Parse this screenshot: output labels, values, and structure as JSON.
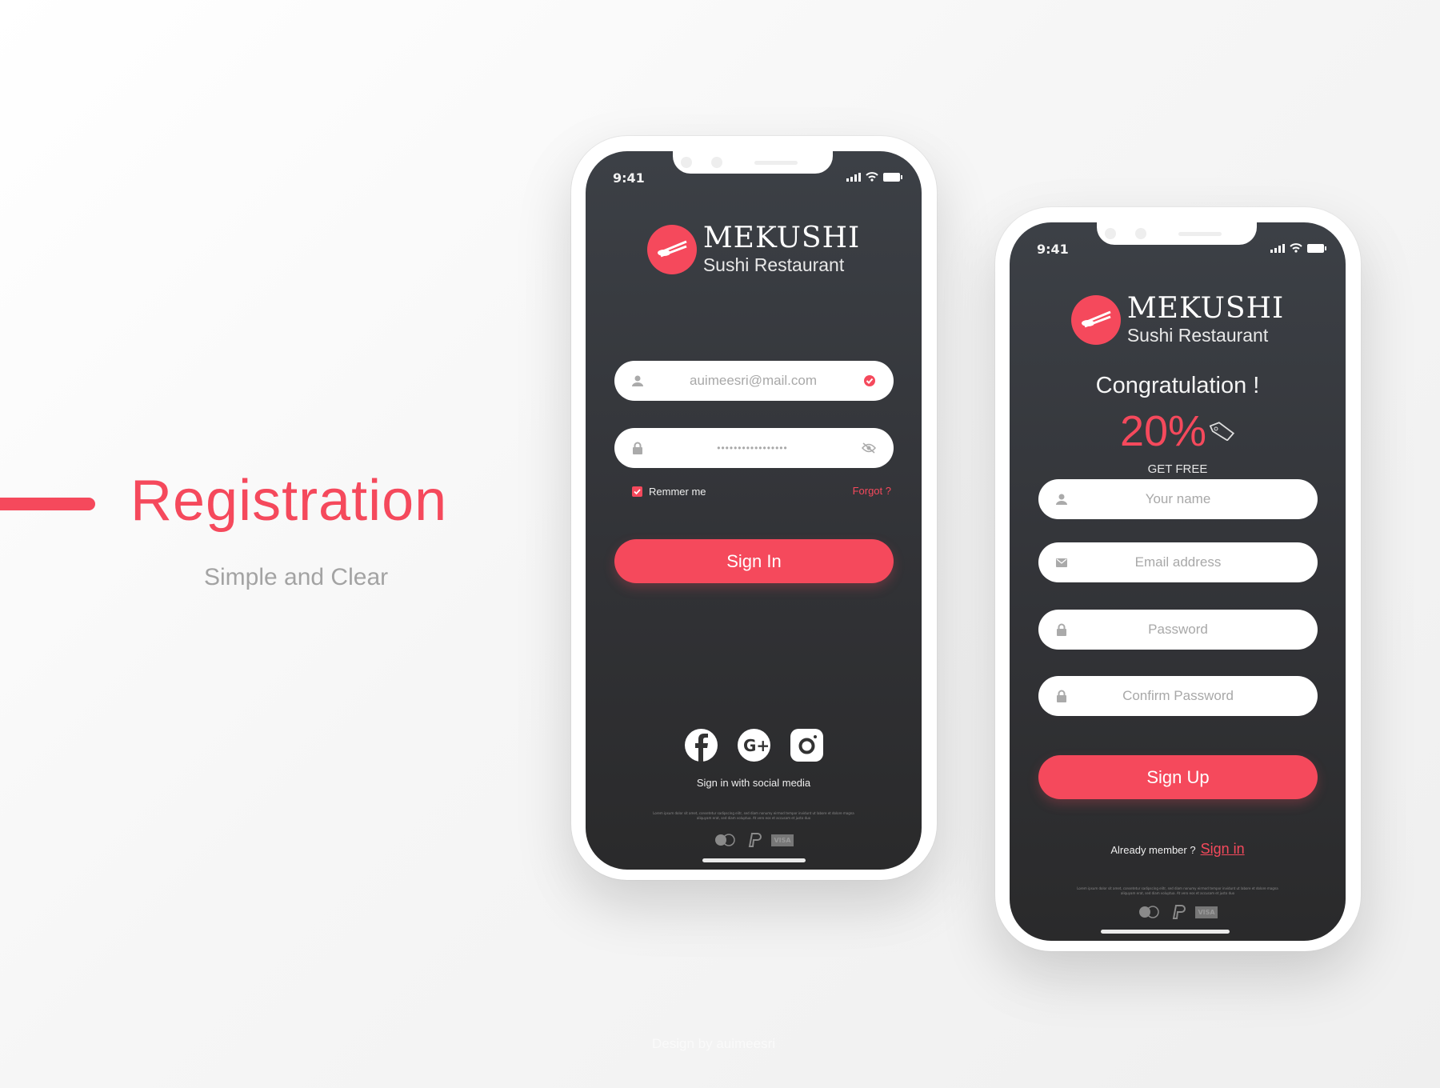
{
  "hero": {
    "title": "Registration",
    "subtitle": "Simple and Clear",
    "credit": "Design by auimeesri"
  },
  "colors": {
    "accent": "#f5495c",
    "screen": "#35373b"
  },
  "login": {
    "status_time": "9:41",
    "brand": {
      "name": "MEKUSHI",
      "tagline": "Sushi Restaurant"
    },
    "email": {
      "value": "auimeesri@mail.com",
      "icon": "user-icon",
      "status_icon": "check-circle-icon"
    },
    "password": {
      "value": "•••••••••••••••••",
      "icon": "lock-icon",
      "toggle_icon": "eye-off-icon"
    },
    "remember_label": "Remmer me",
    "remember_checked": true,
    "forgot_label": "Forgot ?",
    "submit_label": "Sign In",
    "social_icons": [
      "facebook-icon",
      "google-plus-icon",
      "instagram-icon"
    ],
    "social_caption": "Sign in with social media",
    "fine_print": "Lorem ipsum dolor sit amet, consetetur sadipscing elitr, sed diam nonumy eirmod tempor invidunt ut labore et dolore magna aliquyam erat, sed diam voluptua. At vero eos et accusam et justo duo",
    "payments": {
      "visa": "VISA"
    }
  },
  "signup": {
    "status_time": "9:41",
    "brand": {
      "name": "MEKUSHI",
      "tagline": "Sushi Restaurant"
    },
    "congrats": "Congratulation !",
    "discount": "20%",
    "discount_caption": "GET FREE",
    "fields": [
      {
        "placeholder": "Your name",
        "icon": "user-icon"
      },
      {
        "placeholder": "Email address",
        "icon": "mail-icon"
      },
      {
        "placeholder": "Password",
        "icon": "lock-icon"
      },
      {
        "placeholder": "Confirm Password",
        "icon": "lock-icon"
      }
    ],
    "submit_label": "Sign Up",
    "member_text": "Already member ?",
    "signin_link": "Sign in",
    "fine_print": "Lorem ipsum dolor sit amet, consetetur sadipscing elitr, sed diam nonumy eirmod tempor invidunt ut labore et dolore magna aliquyam erat, sed diam voluptua. At vero eos et accusam et justo duo",
    "payments": {
      "visa": "VISA"
    }
  }
}
